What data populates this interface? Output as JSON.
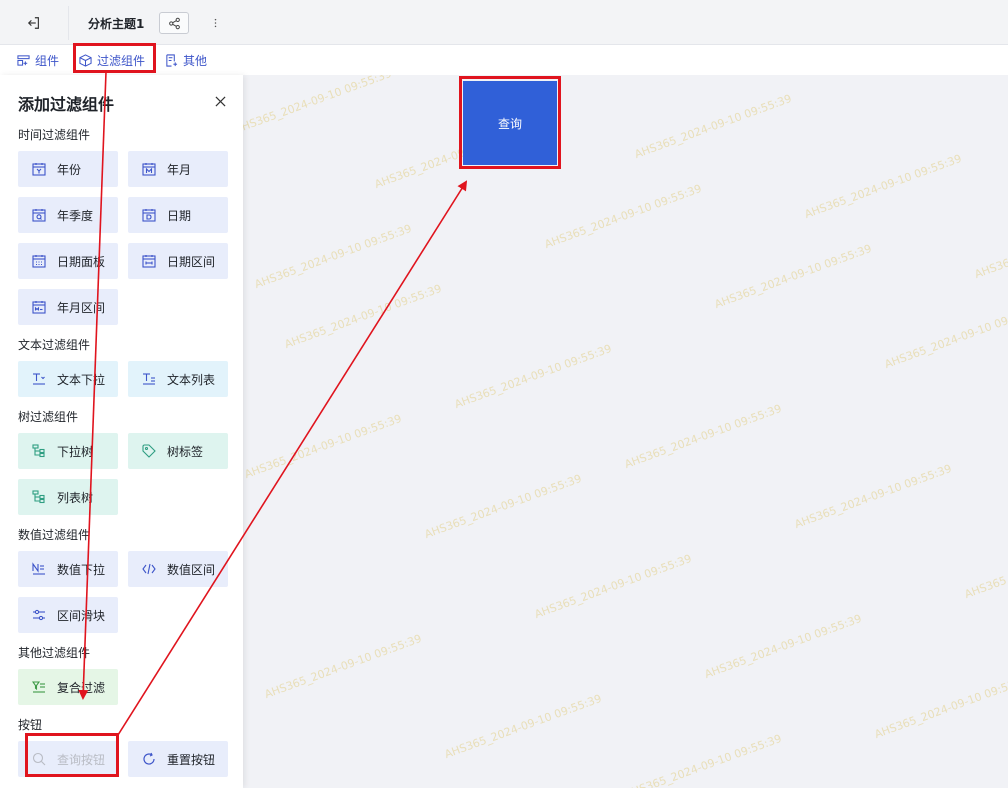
{
  "header": {
    "title": "分析主题1"
  },
  "toolbar": {
    "items": [
      {
        "label": "组件"
      },
      {
        "label": "过滤组件"
      },
      {
        "label": "其他"
      }
    ]
  },
  "panel": {
    "title": "添加过滤组件",
    "sections": {
      "time": "时间过滤组件",
      "text": "文本过滤组件",
      "tree": "树过滤组件",
      "number": "数值过滤组件",
      "other": "其他过滤组件",
      "button": "按钮"
    },
    "items": {
      "year": "年份",
      "year_month": "年月",
      "year_quarter": "年季度",
      "date": "日期",
      "date_panel": "日期面板",
      "date_range": "日期区间",
      "year_month_range": "年月区间",
      "text_dropdown": "文本下拉",
      "text_list": "文本列表",
      "dropdown_tree": "下拉树",
      "tree_tag": "树标签",
      "list_tree": "列表树",
      "number_dropdown": "数值下拉",
      "number_range": "数值区间",
      "range_slider": "区间滑块",
      "compound_filter": "复合过滤",
      "query_button": "查询按钮",
      "reset_button": "重置按钮"
    }
  },
  "canvas": {
    "query_widget_label": "查询"
  },
  "watermark": "AHS365_2024-09-10 09:55:39",
  "colors": {
    "accent": "#3060d8",
    "highlight": "#e0141e",
    "link": "#3d55c9"
  }
}
